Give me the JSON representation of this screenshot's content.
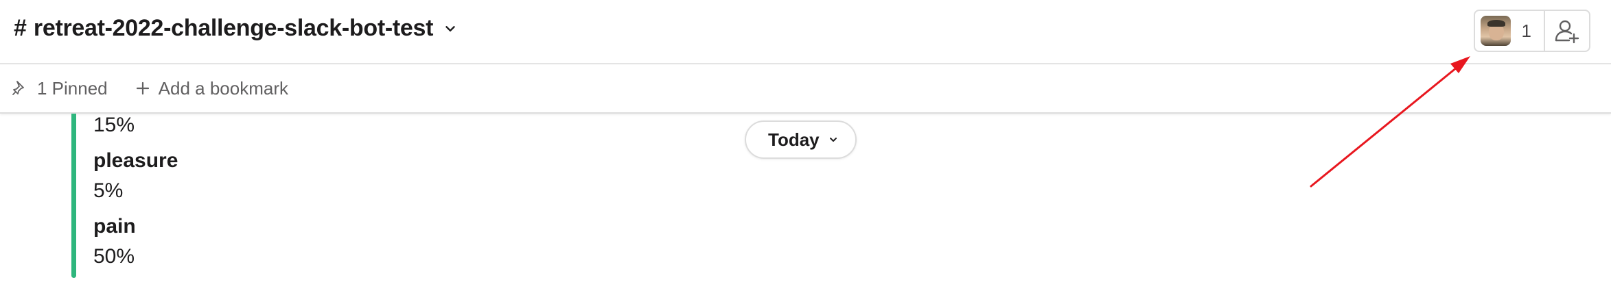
{
  "header": {
    "hash": "#",
    "channel_name": "retreat-2022-challenge-slack-bot-test",
    "member_count": "1"
  },
  "bookmarks": {
    "pinned_label": "1 Pinned",
    "add_label": "Add a bookmark"
  },
  "message": {
    "fields": [
      {
        "value": "15%"
      },
      {
        "title": "pleasure",
        "value": "5%"
      },
      {
        "title": "pain",
        "value": "50%"
      }
    ],
    "accent_color": "#2eb67d"
  },
  "date_divider": {
    "label": "Today"
  },
  "annotation": {
    "color": "#e8171f"
  }
}
